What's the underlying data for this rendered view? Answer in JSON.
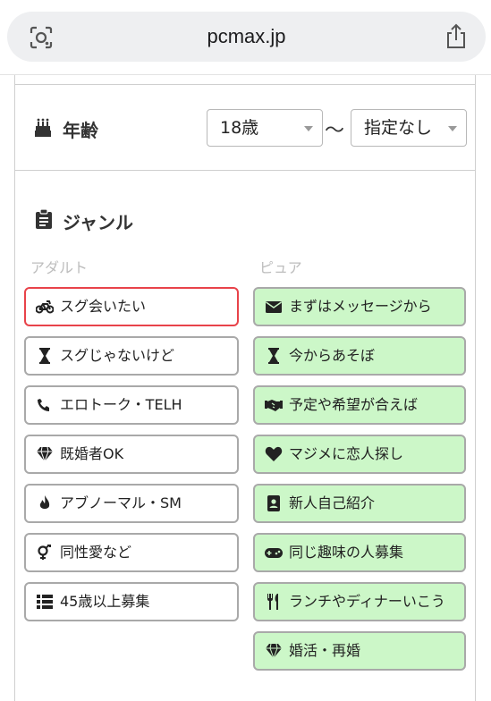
{
  "browser": {
    "url": "pcmax.jp"
  },
  "age": {
    "label": "年齢",
    "min_value": "18歳",
    "separator": "〜",
    "max_value": "指定なし"
  },
  "genre": {
    "label": "ジャンル",
    "adult": {
      "label": "アダルト",
      "items": [
        {
          "label": "スグ会いたい",
          "icon": "motorcycle-icon",
          "selected": true
        },
        {
          "label": "スグじゃないけど",
          "icon": "hourglass-icon",
          "selected": false
        },
        {
          "label": "エロトーク・TELH",
          "icon": "phone-icon",
          "selected": false
        },
        {
          "label": "既婚者OK",
          "icon": "diamond-icon",
          "selected": false
        },
        {
          "label": "アブノーマル・SM",
          "icon": "flame-icon",
          "selected": false
        },
        {
          "label": "同性愛など",
          "icon": "genderless-icon",
          "selected": false
        },
        {
          "label": "45歳以上募集",
          "icon": "list-icon",
          "selected": false
        }
      ]
    },
    "pure": {
      "label": "ピュア",
      "items": [
        {
          "label": "まずはメッセージから",
          "icon": "envelope-icon"
        },
        {
          "label": "今からあそぼ",
          "icon": "hourglass-icon"
        },
        {
          "label": "予定や希望が合えば",
          "icon": "handshake-icon"
        },
        {
          "label": "マジメに恋人探し",
          "icon": "heart-icon"
        },
        {
          "label": "新人自己紹介",
          "icon": "id-badge-icon"
        },
        {
          "label": "同じ趣味の人募集",
          "icon": "gamepad-icon"
        },
        {
          "label": "ランチやディナーいこう",
          "icon": "utensils-icon"
        },
        {
          "label": "婚活・再婚",
          "icon": "diamond-icon"
        }
      ]
    }
  },
  "colors": {
    "selected_border": "#e8434a",
    "pure_bg": "#ccf7c8"
  }
}
